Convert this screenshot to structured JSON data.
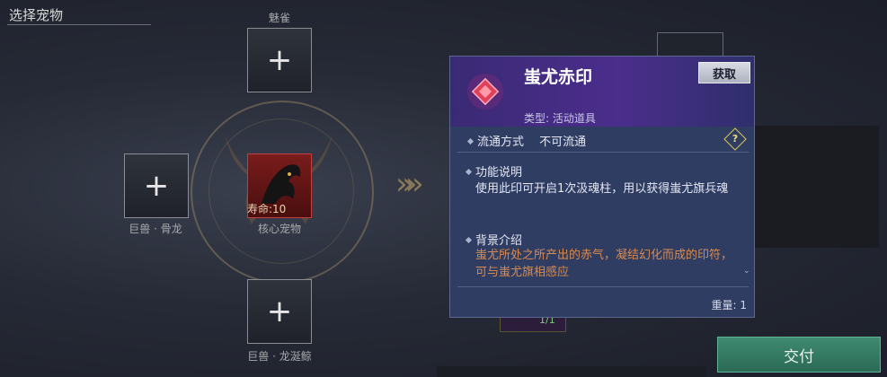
{
  "header": {
    "title": "选择宠物"
  },
  "slots": {
    "top": {
      "label": "魅雀"
    },
    "left": {
      "label": "巨兽 · 骨龙"
    },
    "center": {
      "label": "核心宠物",
      "lifespan": "寿命:10"
    },
    "bottom": {
      "label": "巨兽 · 龙涎鲸"
    }
  },
  "icons": {
    "plus": "+",
    "arrows": "»",
    "help": "?"
  },
  "background": {
    "count": "1/1"
  },
  "actions": {
    "deliver_label": "交付"
  },
  "tooltip": {
    "title": "蚩尤赤印",
    "get_label": "获取",
    "type": "类型: 活动道具",
    "circulation": {
      "label": "流通方式",
      "value": "不可流通"
    },
    "function": {
      "heading": "功能说明",
      "body": "使用此印可开启1次汲魂柱，用以获得蚩尤旗兵魂"
    },
    "background_info": {
      "heading": "背景介绍",
      "body": "蚩尤所处之所产出的赤气，凝结幻化而成的印符，可与蚩尤旗相感应"
    },
    "weight": "重量: 1",
    "scroll_indicator": "⌄"
  },
  "colors": {
    "accent_purple": "#4b2d8c",
    "tooltip_bg": "#2f3d63",
    "deliver_green": "#3f8a70",
    "warning_orange": "#d98a4e",
    "center_slot_red": "#7a1c1c"
  }
}
